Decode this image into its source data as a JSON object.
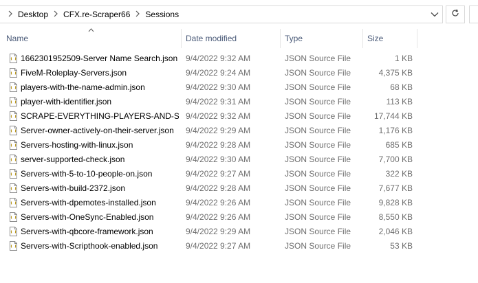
{
  "address": {
    "crumbs": [
      "Desktop",
      "CFX.re-Scraper66",
      "Sessions"
    ]
  },
  "columns": {
    "name": "Name",
    "date": "Date modified",
    "type": "Type",
    "size": "Size"
  },
  "files": [
    {
      "name": "1662301952509-Server Name Search.json",
      "date": "9/4/2022 9:32 AM",
      "type": "JSON Source File",
      "size": "1 KB"
    },
    {
      "name": "FiveM-Roleplay-Servers.json",
      "date": "9/4/2022 9:24 AM",
      "type": "JSON Source File",
      "size": "4,375 KB"
    },
    {
      "name": "players-with-the-name-admin.json",
      "date": "9/4/2022 9:30 AM",
      "type": "JSON Source File",
      "size": "68 KB"
    },
    {
      "name": "player-with-identifier.json",
      "date": "9/4/2022 9:31 AM",
      "type": "JSON Source File",
      "size": "113 KB"
    },
    {
      "name": "SCRAPE-EVERYTHING-PLAYERS-AND-SE...",
      "date": "9/4/2022 9:32 AM",
      "type": "JSON Source File",
      "size": "17,744 KB"
    },
    {
      "name": "Server-owner-actively-on-their-server.json",
      "date": "9/4/2022 9:29 AM",
      "type": "JSON Source File",
      "size": "1,176 KB"
    },
    {
      "name": "Servers-hosting-with-linux.json",
      "date": "9/4/2022 9:28 AM",
      "type": "JSON Source File",
      "size": "685 KB"
    },
    {
      "name": "server-supported-check.json",
      "date": "9/4/2022 9:30 AM",
      "type": "JSON Source File",
      "size": "7,700 KB"
    },
    {
      "name": "Servers-with-5-to-10-people-on.json",
      "date": "9/4/2022 9:27 AM",
      "type": "JSON Source File",
      "size": "322 KB"
    },
    {
      "name": "Servers-with-build-2372.json",
      "date": "9/4/2022 9:28 AM",
      "type": "JSON Source File",
      "size": "7,677 KB"
    },
    {
      "name": "Servers-with-dpemotes-installed.json",
      "date": "9/4/2022 9:26 AM",
      "type": "JSON Source File",
      "size": "9,828 KB"
    },
    {
      "name": "Servers-with-OneSync-Enabled.json",
      "date": "9/4/2022 9:26 AM",
      "type": "JSON Source File",
      "size": "8,550 KB"
    },
    {
      "name": "Servers-with-qbcore-framework.json",
      "date": "9/4/2022 9:29 AM",
      "type": "JSON Source File",
      "size": "2,046 KB"
    },
    {
      "name": "Servers-with-Scripthook-enabled.json",
      "date": "9/4/2022 9:27 AM",
      "type": "JSON Source File",
      "size": "53 KB"
    }
  ],
  "icons": {
    "file": "json-file-icon",
    "chevron": "chevron-right-icon",
    "dropdown": "chevron-down-icon",
    "refresh": "refresh-icon",
    "sort": "sort-up-icon"
  }
}
